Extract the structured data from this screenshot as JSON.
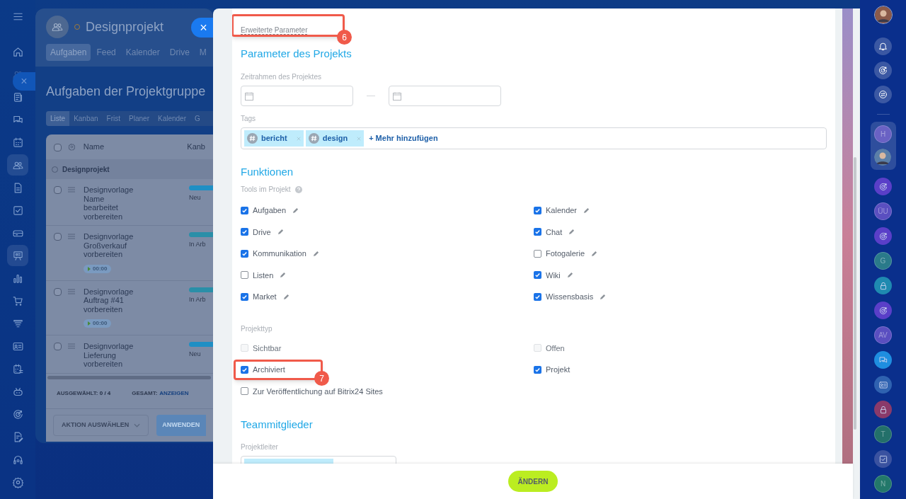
{
  "background_page": {
    "title": "Designprojekt",
    "close_label": "×",
    "tabs": [
      {
        "label": "Aufgaben",
        "selected": true
      },
      {
        "label": "Feed",
        "selected": false
      },
      {
        "label": "Kalender",
        "selected": false
      },
      {
        "label": "Drive",
        "selected": false
      },
      {
        "label": "M",
        "selected": false
      }
    ],
    "heading": "Aufgaben der Projektgruppe",
    "views": [
      {
        "label": "Liste",
        "selected": true
      },
      {
        "label": "Kanban",
        "selected": false
      },
      {
        "label": "Frist",
        "selected": false
      },
      {
        "label": "Planer",
        "selected": false
      },
      {
        "label": "Kalender",
        "selected": false
      },
      {
        "label": "G",
        "selected": false
      }
    ],
    "table": {
      "columns": [
        "Name",
        "Kanb"
      ],
      "all_checked": false,
      "group": "Designprojekt",
      "rows": [
        {
          "name": "Designvorlage Name bearbeitet vorbereiten",
          "stage": "Neu",
          "color": "#1f8fc4",
          "checked": false
        },
        {
          "name": "Designvorlage Großverkauf vorbereiten",
          "stage": "In Arb",
          "color": "#2a8fa8",
          "timer": "00:00",
          "checked": false
        },
        {
          "name": "Designvorlage Auftrag #41 vorbereiten",
          "stage": "In Arb",
          "color": "#2a8fa8",
          "timer": "00:00",
          "checked": false
        },
        {
          "name": "Designvorlage Lieferung vorbereiten",
          "stage": "Neu",
          "color": "#1f8fc4",
          "checked": false
        }
      ]
    },
    "footer": {
      "selected_label": "AUSGEWÄHLT:",
      "selected_value": "0 / 4",
      "total_label": "GESAMT:",
      "total_link": "ANZEIGEN",
      "action": "AKTION AUSWÄHLEN",
      "apply": "ANWENDEN"
    }
  },
  "left_close": "×",
  "form": {
    "advanced_link": "Erweiterte Parameter",
    "advanced_callout": "6",
    "params_title": "Parameter des Projekts",
    "timeframe_label": "Zeitrahmen des Projektes",
    "tags_label": "Tags",
    "tags": [
      "bericht",
      "design"
    ],
    "add_tag": "+ Mehr hinzufügen",
    "functions_title": "Funktionen",
    "tools_label": "Tools im Projekt",
    "tool_columns": [
      [
        {
          "label": "Aufgaben",
          "checked": true
        },
        {
          "label": "Drive",
          "checked": true
        },
        {
          "label": "Kommunikation",
          "checked": true
        },
        {
          "label": "Listen",
          "checked": false
        },
        {
          "label": "Market",
          "checked": true
        }
      ],
      [
        {
          "label": "Kalender",
          "checked": true
        },
        {
          "label": "Chat",
          "checked": true
        },
        {
          "label": "Fotogalerie",
          "checked": false
        },
        {
          "label": "Wiki",
          "checked": true
        },
        {
          "label": "Wissensbasis",
          "checked": true
        }
      ]
    ],
    "type_label": "Projekttyp",
    "type_columns": [
      [
        {
          "label": "Sichtbar",
          "checked": false,
          "disabled": true
        },
        {
          "label": "Archiviert",
          "checked": true,
          "disabled": false,
          "callout": "7"
        },
        {
          "label": "Zur Veröffentlichung auf Bitrix24 Sites",
          "checked": false,
          "disabled": false
        }
      ],
      [
        {
          "label": "Offen",
          "checked": false,
          "disabled": true
        },
        {
          "label": "Projekt",
          "checked": true,
          "disabled": false
        }
      ]
    ],
    "team_title": "Teammitglieder",
    "leader_label": "Projektleiter"
  },
  "submit": "ÄNDERN",
  "right_bar": {
    "pinned": [
      {
        "kind": "letter",
        "label": "H",
        "color": "#6a62c4"
      },
      {
        "kind": "person",
        "color": "#5b7fa8"
      }
    ],
    "items": [
      {
        "kind": "target",
        "color": "#5a3fc8"
      },
      {
        "kind": "letter",
        "label": "ÜU",
        "color": "#5a4fc0"
      },
      {
        "kind": "target",
        "color": "#5a3fc8"
      },
      {
        "kind": "letter",
        "label": "G",
        "color": "#2a7a8a"
      },
      {
        "kind": "lock",
        "color": "#1f8ab0"
      },
      {
        "kind": "target",
        "color": "#5a3fc8"
      },
      {
        "kind": "letter",
        "label": "AV",
        "color": "#5a4fc0"
      },
      {
        "kind": "chat",
        "color": "#1f8ee0"
      },
      {
        "kind": "card",
        "color": "#2f62b0"
      },
      {
        "kind": "lock",
        "color": "#8a3a6a"
      },
      {
        "kind": "letter",
        "label": "T",
        "color": "#23706a"
      },
      {
        "kind": "check",
        "color": "#3a52a0"
      },
      {
        "kind": "letter",
        "label": "N",
        "color": "#23786a"
      }
    ]
  }
}
